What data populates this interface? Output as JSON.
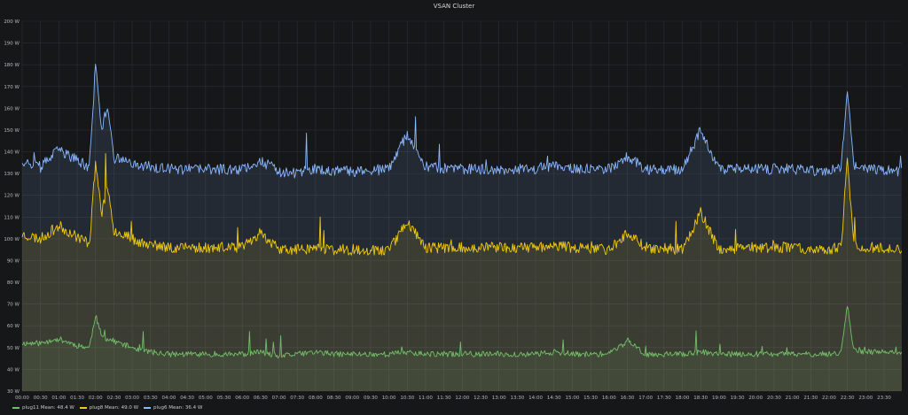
{
  "chart_data": {
    "type": "line",
    "title": "VSAN Cluster",
    "ylim": [
      30,
      200
    ],
    "y_ticks": [
      "30 W",
      "40 W",
      "50 W",
      "60 W",
      "70 W",
      "80 W",
      "90 W",
      "100 W",
      "110 W",
      "120 W",
      "130 W",
      "140 W",
      "150 W",
      "160 W",
      "170 W",
      "180 W",
      "190 W",
      "200 W"
    ],
    "x_ticks": [
      "00:00",
      "00:30",
      "01:00",
      "01:30",
      "02:00",
      "02:30",
      "03:00",
      "03:30",
      "04:00",
      "04:30",
      "05:00",
      "05:30",
      "06:00",
      "06:30",
      "07:00",
      "07:30",
      "08:00",
      "08:30",
      "09:00",
      "09:30",
      "10:00",
      "10:30",
      "11:00",
      "11:30",
      "12:00",
      "12:30",
      "13:00",
      "13:30",
      "14:00",
      "14:30",
      "15:00",
      "15:30",
      "16:00",
      "16:30",
      "17:00",
      "17:30",
      "18:00",
      "18:30",
      "19:00",
      "19:30",
      "20:00",
      "20:30",
      "21:00",
      "21:30",
      "22:00",
      "22:30",
      "23:00",
      "23:30"
    ],
    "grid": true,
    "legend_position": "bottom-left",
    "series": [
      {
        "name": "plug11",
        "legend": "plug11 Mean: 48.4 W",
        "color": "#73bf69",
        "x": [
          "00:00",
          "00:30",
          "01:00",
          "01:30",
          "01:50",
          "02:00",
          "02:10",
          "02:30",
          "03:00",
          "03:30",
          "04:00",
          "05:00",
          "06:00",
          "06:30",
          "07:00",
          "07:30",
          "08:00",
          "08:30",
          "09:00",
          "10:00",
          "10:30",
          "11:00",
          "12:00",
          "13:00",
          "14:00",
          "14:30",
          "15:00",
          "16:00",
          "16:30",
          "17:00",
          "18:00",
          "18:30",
          "19:00",
          "20:00",
          "21:00",
          "22:00",
          "22:20",
          "22:30",
          "22:40",
          "23:00",
          "23:30",
          "23:59"
        ],
        "values": [
          52,
          52,
          54,
          51,
          50,
          65,
          55,
          53,
          50,
          48,
          47,
          47,
          47,
          48,
          46,
          47,
          48,
          47,
          47,
          47,
          48,
          47,
          47,
          47,
          47,
          48,
          47,
          47,
          53,
          47,
          47,
          48,
          47,
          47,
          47,
          47,
          48,
          70,
          49,
          48,
          48,
          47
        ]
      },
      {
        "name": "plug8",
        "legend": "plug8 Mean: 49.0 W",
        "color": "#f2cc0c",
        "x": [
          "00:00",
          "00:30",
          "01:00",
          "01:30",
          "01:50",
          "02:00",
          "02:10",
          "02:20",
          "02:30",
          "03:00",
          "03:30",
          "04:00",
          "05:00",
          "06:00",
          "06:30",
          "07:00",
          "07:30",
          "08:00",
          "08:30",
          "09:00",
          "10:00",
          "10:30",
          "11:00",
          "12:00",
          "13:00",
          "14:00",
          "14:30",
          "15:00",
          "16:00",
          "16:30",
          "17:00",
          "18:00",
          "18:30",
          "19:00",
          "20:00",
          "21:00",
          "22:00",
          "22:20",
          "22:30",
          "22:40",
          "23:00",
          "23:30",
          "23:59"
        ],
        "values": [
          102,
          100,
          106,
          101,
          98,
          135,
          112,
          125,
          104,
          100,
          97,
          96,
          96,
          96,
          103,
          95,
          95,
          96,
          95,
          95,
          95,
          108,
          96,
          96,
          96,
          96,
          97,
          96,
          95,
          103,
          96,
          95,
          112,
          95,
          96,
          96,
          95,
          96,
          137,
          98,
          96,
          96,
          95
        ]
      },
      {
        "name": "plug6",
        "legend": "plug6 Mean: 36.4 W",
        "color": "#8ab8ff",
        "x": [
          "00:00",
          "00:30",
          "01:00",
          "01:30",
          "01:50",
          "02:00",
          "02:10",
          "02:20",
          "02:30",
          "03:00",
          "03:30",
          "04:00",
          "05:00",
          "06:00",
          "06:30",
          "07:00",
          "07:30",
          "08:00",
          "08:30",
          "09:00",
          "10:00",
          "10:30",
          "11:00",
          "12:00",
          "13:00",
          "14:00",
          "14:30",
          "15:00",
          "16:00",
          "16:30",
          "17:00",
          "18:00",
          "18:30",
          "19:00",
          "20:00",
          "21:00",
          "22:00",
          "22:20",
          "22:30",
          "22:40",
          "23:00",
          "23:30",
          "23:59"
        ],
        "values": [
          136,
          133,
          141,
          136,
          133,
          180,
          150,
          162,
          137,
          135,
          133,
          132,
          132,
          132,
          136,
          131,
          130,
          132,
          131,
          131,
          132,
          148,
          133,
          132,
          132,
          132,
          134,
          132,
          132,
          138,
          132,
          132,
          150,
          132,
          132,
          132,
          131,
          133,
          170,
          134,
          132,
          132,
          131
        ]
      }
    ]
  }
}
